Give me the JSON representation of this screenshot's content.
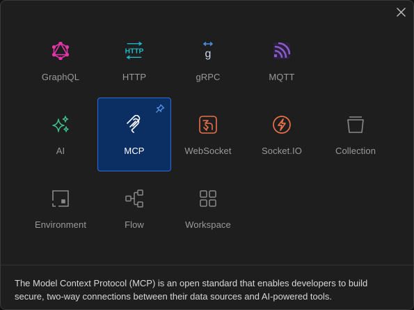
{
  "dialog": {
    "close_icon": "close-icon",
    "items": [
      {
        "label": "GraphQL",
        "icon": "graphql-icon",
        "color": "#e535ab"
      },
      {
        "label": "HTTP",
        "icon": "http-icon",
        "color": "#20b9c8"
      },
      {
        "label": "gRPC",
        "icon": "grpc-icon",
        "color": "#4a90e2"
      },
      {
        "label": "MQTT",
        "icon": "mqtt-icon",
        "color": "#8a5cc7"
      },
      {
        "label": "AI",
        "icon": "sparkles-icon",
        "color": "#3fbf8a"
      },
      {
        "label": "MCP",
        "icon": "mcp-icon",
        "color": "#ffffff",
        "selected": true,
        "pinned": true
      },
      {
        "label": "WebSocket",
        "icon": "websocket-icon",
        "color": "#e8714a"
      },
      {
        "label": "Socket.IO",
        "icon": "socketio-icon",
        "color": "#e8714a"
      },
      {
        "label": "Collection",
        "icon": "collection-icon",
        "color": "#8a8a8a"
      },
      {
        "label": "Environment",
        "icon": "environment-icon",
        "color": "#8a8a8a"
      },
      {
        "label": "Flow",
        "icon": "flow-icon",
        "color": "#8a8a8a"
      },
      {
        "label": "Workspace",
        "icon": "workspace-icon",
        "color": "#8a8a8a"
      }
    ],
    "description": "The Model Context Protocol (MCP) is an open standard that enables developers to build secure, two-way connections between their data sources and AI-powered tools."
  },
  "colors": {
    "background": "#1e1e1e",
    "selected_bg": "#0b2f63",
    "selected_border": "#2b6fd6",
    "label": "#9a9a9a"
  }
}
